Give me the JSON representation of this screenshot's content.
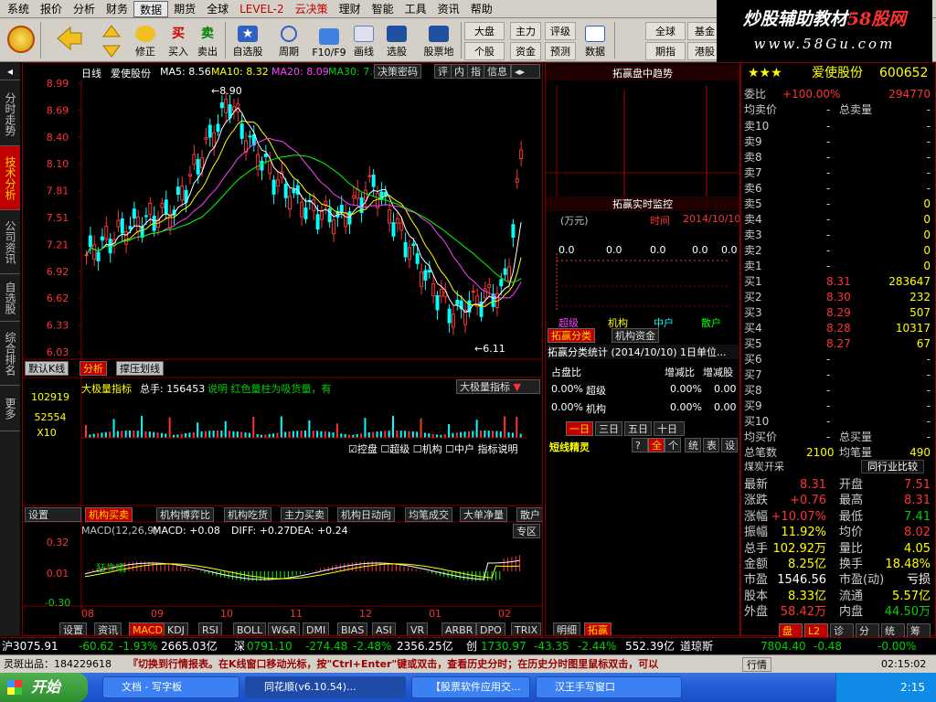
{
  "menu": [
    "系统",
    "报价",
    "分析",
    "财务",
    "数据",
    "期货",
    "全球",
    "LEVEL-2",
    "云决策",
    "理财",
    "智能",
    "工具",
    "资讯",
    "帮助"
  ],
  "watermark": {
    "line1a": "炒股辅助教材",
    "line1b": "58股网",
    "line2": "www.58Gu.com"
  },
  "toolbar": {
    "big": [
      {
        "label": "",
        "icon": "coin-icon"
      },
      {
        "label": "",
        "icon": "back-arrow-icon"
      },
      {
        "label": "",
        "icon": "up-down-arrows-icon"
      },
      {
        "label": "修正",
        "icon": "smile-icon"
      },
      {
        "label": "买入",
        "icon": "buy-icon",
        "glyph": "买"
      },
      {
        "label": "卖出",
        "icon": "sell-icon",
        "glyph": "卖"
      },
      {
        "label": "自选股",
        "icon": "star-icon"
      },
      {
        "label": "周期",
        "icon": "clock-icon"
      },
      {
        "label": "F10/F9",
        "icon": "f10-icon"
      },
      {
        "label": "画线",
        "icon": "pen-icon"
      },
      {
        "label": "选股",
        "icon": "screen-icon"
      },
      {
        "label": "股票地",
        "icon": "chart-icon"
      }
    ],
    "small": [
      [
        "大盘",
        "全球",
        "基金"
      ],
      [
        "个股",
        "期指",
        "港股"
      ],
      [
        "主力",
        "评级"
      ],
      [
        "资金",
        "预测"
      ],
      [
        "数据"
      ]
    ]
  },
  "chart": {
    "header": {
      "period": "日线",
      "name": "爱使股份",
      "ma5": "MA5: 8.56",
      "ma10": "MA10: 8.32",
      "ma20": "MA20: 8.09",
      "ma30": "MA30: 7.6",
      "btn": "决策密码",
      "tabs": [
        "评",
        "内",
        "指",
        "信息"
      ]
    },
    "yticks": [
      "8.99",
      "8.69",
      "8.40",
      "8.10",
      "7.81",
      "7.51",
      "7.21",
      "6.92",
      "6.62",
      "6.33",
      "6.03"
    ],
    "hi_label": "8.90",
    "lo_label": "6.11",
    "subtabs": [
      "默认K线",
      "分析",
      "撑压划线"
    ],
    "vol": {
      "title": "大极量指标",
      "total": "总手: 156453",
      "desc": "说明 红色量柱为吸货量，有",
      "select": "大极量指标",
      "y1": "102919",
      "y2": "52554",
      "y3": "X10",
      "checks": [
        "控盘",
        "超级",
        "机构",
        "中户",
        "指标说明"
      ]
    },
    "toolrow": [
      "设置",
      "机构买卖",
      "机构博弈比",
      "机构吃货",
      "主力买卖",
      "机构日动向",
      "均笔成交",
      "大单净量",
      "散户"
    ],
    "macd": {
      "title": "MACD(12,26,9)",
      "macd": "MACD: +0.08",
      "diff": "DIFF: +0.27",
      "dea": "DEA: +0.24",
      "btn": "专区",
      "y1": "0.32",
      "y2": "0.01",
      "y3": "-0.30",
      "tag": "狂牛吼",
      "xlabels": [
        "08",
        "09",
        "10",
        "11",
        "12",
        "01",
        "02"
      ]
    },
    "bottomtabs": [
      "设置",
      "资讯",
      "MACD",
      "KDJ",
      "RSI",
      "BOLL",
      "W&R",
      "DMI",
      "BIAS",
      "ASI",
      "VR",
      "ARBR",
      "DPO",
      "TRIX"
    ]
  },
  "mid": {
    "t1": "拓赢盘中趋势",
    "t2": "拓赢实时监控",
    "unit": "(万元)",
    "time": "时间",
    "date": "2014/10/10",
    "zeros": [
      "0.0",
      "0.0",
      "0.0",
      "0.0",
      "0.0"
    ],
    "legend": [
      "超级",
      "机构",
      "中户",
      "散户"
    ],
    "tabs2": [
      "拓赢分类",
      "机构资金"
    ],
    "stat_title": "拓赢分类统计 (2014/10/10) 1日单位...",
    "cols": [
      "占盘比",
      "增减比",
      "增减股"
    ],
    "rows": [
      [
        "0.00%",
        "超级",
        "0.00%",
        "0.00"
      ],
      [
        "0.00%",
        "机构",
        "0.00%",
        "0.00"
      ]
    ],
    "daytabs": [
      "一日",
      "三日",
      "五日",
      "十日"
    ],
    "elf": "短线精灵",
    "elftabs": [
      "?",
      "全",
      "个",
      "统",
      "表",
      "设"
    ],
    "lowtabs": [
      "明细",
      "拓赢"
    ]
  },
  "quote": {
    "stars": "★★★",
    "name": "爱使股份",
    "code": "600652",
    "wb": {
      "label": "委比",
      "pct": "+100.00%",
      "val": "294770"
    },
    "avgsell": {
      "label": "均卖价",
      "dash": "-",
      "tot": "总卖量",
      "val": "-"
    },
    "sells": [
      [
        "卖10",
        "-",
        "-"
      ],
      [
        "卖9",
        "-",
        "-"
      ],
      [
        "卖8",
        "-",
        "-"
      ],
      [
        "卖7",
        "-",
        "-"
      ],
      [
        "卖6",
        "-",
        "-"
      ],
      [
        "卖5",
        "-",
        "0"
      ],
      [
        "卖4",
        "-",
        "0"
      ],
      [
        "卖3",
        "-",
        "0"
      ],
      [
        "卖2",
        "-",
        "0"
      ],
      [
        "卖1",
        "-",
        "0"
      ]
    ],
    "buys": [
      [
        "买1",
        "8.31",
        "283647"
      ],
      [
        "买2",
        "8.30",
        "232"
      ],
      [
        "买3",
        "8.29",
        "507"
      ],
      [
        "买4",
        "8.28",
        "10317"
      ],
      [
        "买5",
        "8.27",
        "67"
      ],
      [
        "买6",
        "-",
        "-"
      ],
      [
        "买7",
        "-",
        "-"
      ],
      [
        "买8",
        "-",
        "-"
      ],
      [
        "买9",
        "-",
        "-"
      ],
      [
        "买10",
        "-",
        "-"
      ]
    ],
    "avgbuy": {
      "label": "均买价",
      "dash": "-",
      "tot": "总买量",
      "val": "-"
    },
    "zbs": {
      "label": "总笔数",
      "v1": "2100",
      "l2": "均笔量",
      "v2": "490"
    },
    "cat": "煤炭开采",
    "cmp": "同行业比较",
    "stats": [
      [
        "最新",
        "8.31",
        "开盘",
        "7.51"
      ],
      [
        "涨跌",
        "+0.76",
        "最高",
        "8.31"
      ],
      [
        "涨幅",
        "+10.07%",
        "最低",
        "7.41"
      ],
      [
        "振幅",
        "11.92%",
        "均价",
        "8.02"
      ],
      [
        "总手",
        "102.92万",
        "量比",
        "4.05"
      ],
      [
        "金额",
        "8.25亿",
        "换手",
        "18.48%"
      ],
      [
        "市盈",
        "1546.56",
        "市盈(动)",
        "亏损"
      ],
      [
        "股本",
        "8.33亿",
        "流通",
        "5.57亿"
      ],
      [
        "外盘",
        "58.42万",
        "内盘",
        "44.50万"
      ]
    ],
    "bottomtabs": [
      "盘",
      "L2",
      "诊",
      "分",
      "统",
      "筹"
    ]
  },
  "index": {
    "sh": "沪3075.91",
    "sh_chg": "-60.62",
    "sh_pct": "-1.93%",
    "sh_amt": "2665.03亿",
    "sz": "深",
    "sz_v": "0791.10",
    "sz_chg": "-274.48",
    "sz_pct": "-2.48%",
    "sz_amt": "2356.25亿",
    "cy": "创",
    "cy_v": "1730.97",
    "cy_chg": "-43.35",
    "cy_pct": "-2.44%",
    "cy_amt": "552.39亿",
    "dj": "道琼斯",
    "dj_v": "7804.40",
    "dj_chg": "-0.48",
    "dj_pct": "-0.00%"
  },
  "msg": {
    "left": "灵斑出品：184229618",
    "text": "『切换到行情报表。在K线窗口移动光标，按\"Ctrl+Enter\"键或双击，查看历史分时；在历史分时图里鼠标双击，可以",
    "btn": "行情",
    "time": "02:15:02"
  },
  "taskbar": {
    "start": "开始",
    "tasks": [
      "文档 - 写字板",
      "同花顺(v6.10.54)...",
      "【股票软件应用交...",
      "汉王手写窗口"
    ],
    "clock": "2:15"
  },
  "lefttabs": [
    "分时走势",
    "技术分析",
    "公司资讯",
    "自选股",
    "综合排名",
    "更多"
  ]
}
